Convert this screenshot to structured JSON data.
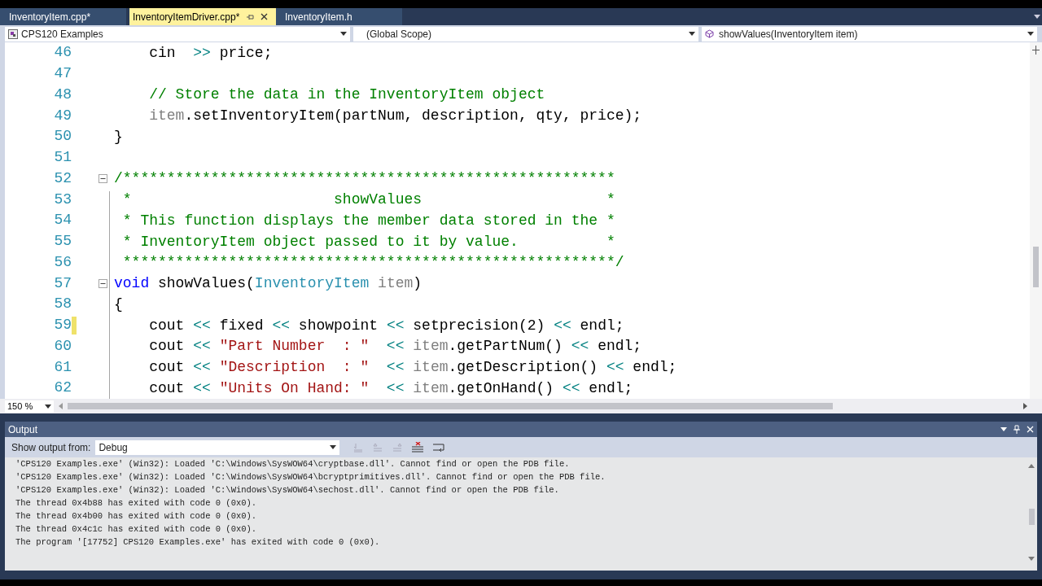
{
  "tabs": [
    {
      "label": "InventoryItem.cpp*",
      "selected": false
    },
    {
      "label": "InventoryItemDriver.cpp*",
      "selected": true
    },
    {
      "label": "InventoryItem.h",
      "selected": false
    }
  ],
  "navigation": {
    "project": "CPS120 Examples",
    "scope": "(Global Scope)",
    "member": "showValues(InventoryItem item)"
  },
  "editor": {
    "zoom": "150 %",
    "lines": [
      {
        "number": "46",
        "changed": false,
        "fold_start": false,
        "tokens": [
          {
            "kind": "plain",
            "text": "    cin  "
          },
          {
            "kind": "operator",
            "text": ">>"
          },
          {
            "kind": "plain",
            "text": " price;"
          }
        ]
      },
      {
        "number": "47",
        "changed": false,
        "fold_start": false
      },
      {
        "number": "48",
        "changed": false,
        "fold_start": false,
        "tokens": [
          {
            "kind": "comment",
            "text": "    // Store the data in the InventoryItem object"
          }
        ]
      },
      {
        "number": "49",
        "changed": false,
        "fold_start": false,
        "tokens": [
          {
            "kind": "param",
            "text": "    item"
          },
          {
            "kind": "plain",
            "text": ".setInventoryItem(partNum, description, qty, price);"
          }
        ]
      },
      {
        "number": "50",
        "changed": false,
        "fold_start": false,
        "tokens": [
          {
            "kind": "plain",
            "text": "}"
          }
        ]
      },
      {
        "number": "51",
        "changed": false,
        "fold_start": false
      },
      {
        "number": "52",
        "changed": false,
        "fold_start": true,
        "tokens": [
          {
            "kind": "comment",
            "text": "/********************************************************"
          }
        ]
      },
      {
        "number": "53",
        "changed": false,
        "fold_start": false,
        "tokens": [
          {
            "kind": "comment",
            "text": " *                       showValues                     *"
          }
        ]
      },
      {
        "number": "54",
        "changed": false,
        "fold_start": false,
        "tokens": [
          {
            "kind": "comment",
            "text": " * This function displays the member data stored in the *"
          }
        ]
      },
      {
        "number": "55",
        "changed": false,
        "fold_start": false,
        "tokens": [
          {
            "kind": "comment",
            "text": " * InventoryItem object passed to it by value.          *"
          }
        ]
      },
      {
        "number": "56",
        "changed": false,
        "fold_start": false,
        "tokens": [
          {
            "kind": "comment",
            "text": " ********************************************************/"
          }
        ]
      },
      {
        "number": "57",
        "changed": false,
        "fold_start": true,
        "tokens": [
          {
            "kind": "keyword",
            "text": "void"
          },
          {
            "kind": "plain",
            "text": " showValues("
          },
          {
            "kind": "type",
            "text": "InventoryItem"
          },
          {
            "kind": "param",
            "text": " item"
          },
          {
            "kind": "plain",
            "text": ")"
          }
        ]
      },
      {
        "number": "58",
        "changed": false,
        "fold_start": false,
        "tokens": [
          {
            "kind": "plain",
            "text": "{"
          }
        ]
      },
      {
        "number": "59",
        "changed": true,
        "fold_start": false,
        "tokens": [
          {
            "kind": "plain",
            "text": "    cout "
          },
          {
            "kind": "operator",
            "text": "<<"
          },
          {
            "kind": "plain",
            "text": " fixed "
          },
          {
            "kind": "operator",
            "text": "<<"
          },
          {
            "kind": "plain",
            "text": " showpoint "
          },
          {
            "kind": "operator",
            "text": "<<"
          },
          {
            "kind": "plain",
            "text": " setprecision(2) "
          },
          {
            "kind": "operator",
            "text": "<<"
          },
          {
            "kind": "plain",
            "text": " endl;"
          }
        ]
      },
      {
        "number": "60",
        "changed": false,
        "fold_start": false,
        "tokens": [
          {
            "kind": "plain",
            "text": "    cout "
          },
          {
            "kind": "operator",
            "text": "<<"
          },
          {
            "kind": "string",
            "text": " \"Part Number  : \""
          },
          {
            "kind": "operator",
            "text": "  <<"
          },
          {
            "kind": "param",
            "text": " item"
          },
          {
            "kind": "plain",
            "text": ".getPartNum() "
          },
          {
            "kind": "operator",
            "text": "<<"
          },
          {
            "kind": "plain",
            "text": " endl;"
          }
        ]
      },
      {
        "number": "61",
        "changed": false,
        "fold_start": false,
        "tokens": [
          {
            "kind": "plain",
            "text": "    cout "
          },
          {
            "kind": "operator",
            "text": "<<"
          },
          {
            "kind": "string",
            "text": " \"Description  : \""
          },
          {
            "kind": "operator",
            "text": "  <<"
          },
          {
            "kind": "param",
            "text": " item"
          },
          {
            "kind": "plain",
            "text": ".getDescription() "
          },
          {
            "kind": "operator",
            "text": "<<"
          },
          {
            "kind": "plain",
            "text": " endl;"
          }
        ]
      },
      {
        "number": "62",
        "changed": false,
        "fold_start": false,
        "tokens": [
          {
            "kind": "plain",
            "text": "    cout "
          },
          {
            "kind": "operator",
            "text": "<<"
          },
          {
            "kind": "string",
            "text": " \"Units On Hand: \""
          },
          {
            "kind": "operator",
            "text": "  <<"
          },
          {
            "kind": "param",
            "text": " item"
          },
          {
            "kind": "plain",
            "text": ".getOnHand() "
          },
          {
            "kind": "operator",
            "text": "<<"
          },
          {
            "kind": "plain",
            "text": " endl;"
          }
        ]
      }
    ]
  },
  "output": {
    "title": "Output",
    "source_label": "Show output from:",
    "source": "Debug",
    "lines": [
      "'CPS120 Examples.exe' (Win32): Loaded 'C:\\Windows\\SysWOW64\\cryptbase.dll'. Cannot find or open the PDB file.",
      "'CPS120 Examples.exe' (Win32): Loaded 'C:\\Windows\\SysWOW64\\bcryptprimitives.dll'. Cannot find or open the PDB file.",
      "'CPS120 Examples.exe' (Win32): Loaded 'C:\\Windows\\SysWOW64\\sechost.dll'. Cannot find or open the PDB file.",
      "The thread 0x4b88 has exited with code 0 (0x0).",
      "The thread 0x4b00 has exited with code 0 (0x0).",
      "The thread 0x4c1c has exited with code 0 (0x0).",
      "The program '[17752] CPS120 Examples.exe' has exited with code 0 (0x0)."
    ]
  }
}
